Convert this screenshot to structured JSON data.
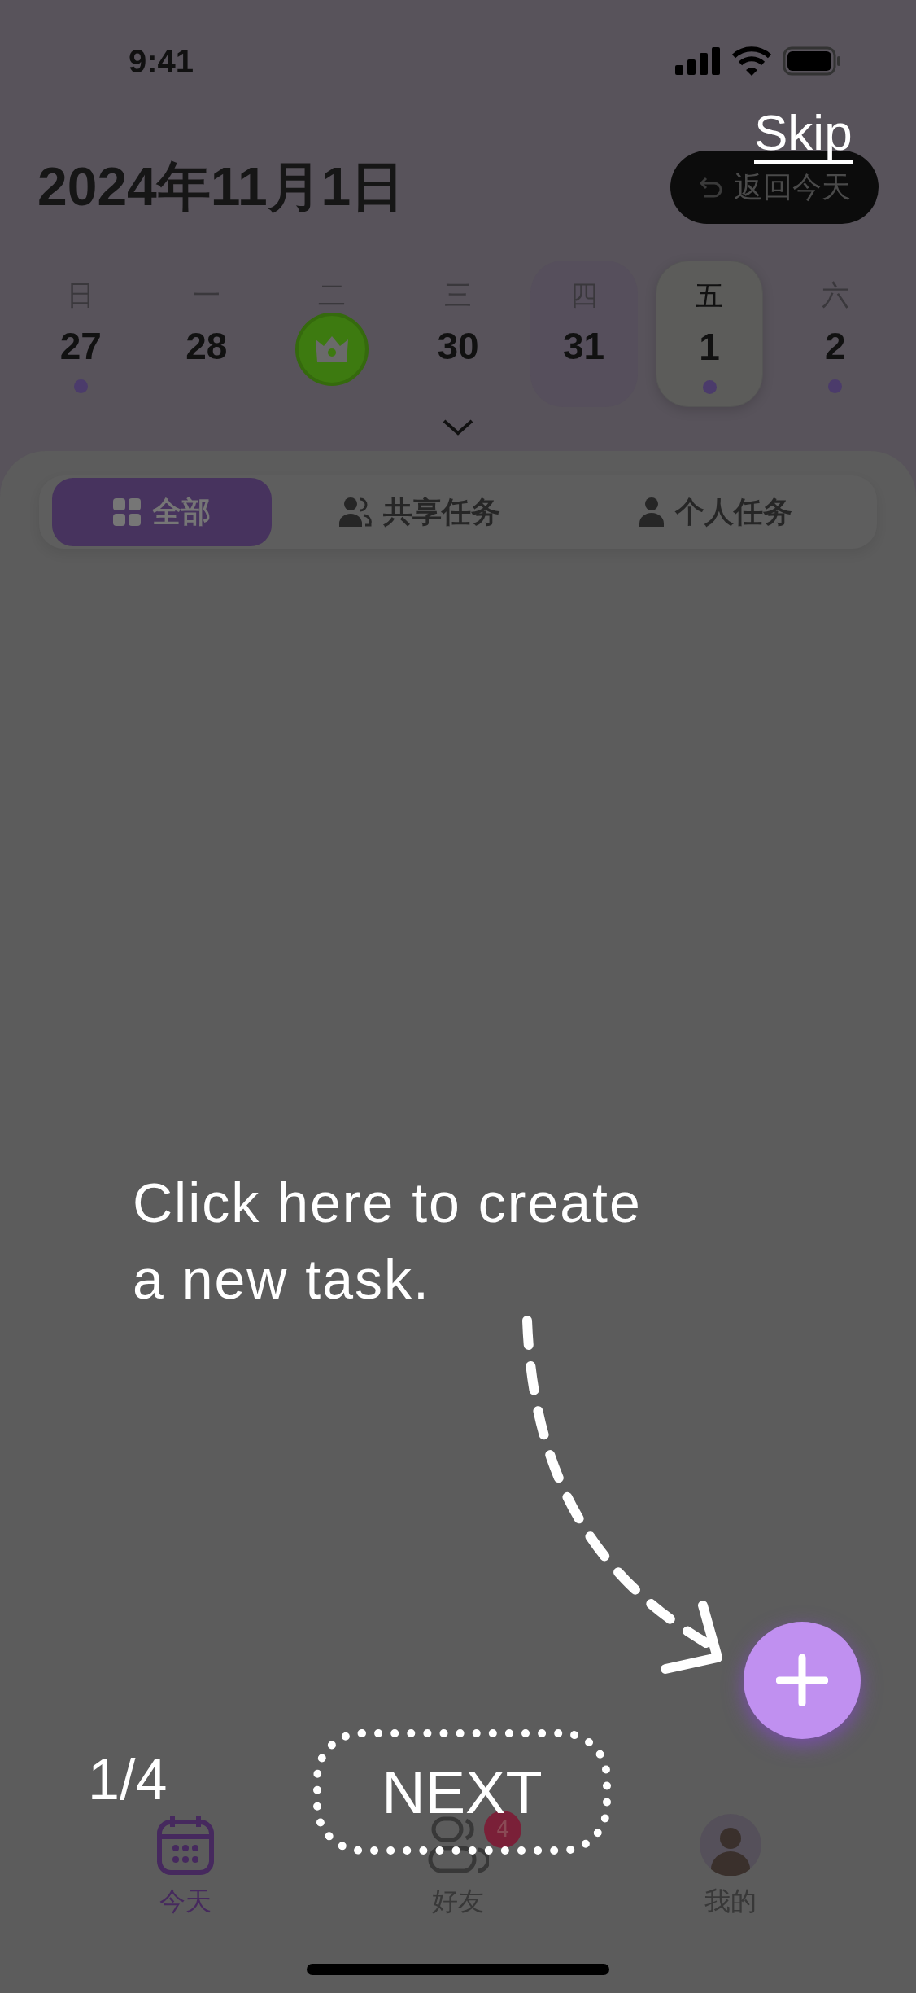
{
  "status_bar": {
    "time": "9:41"
  },
  "header": {
    "date_title": "2024年11月1日",
    "back_today_button": "返回今天"
  },
  "week": [
    {
      "weekday": "日",
      "day": "27",
      "kind": "date",
      "has_task": true,
      "today": false,
      "selected": false
    },
    {
      "weekday": "一",
      "day": "28",
      "kind": "date",
      "has_task": false,
      "today": false,
      "selected": false
    },
    {
      "weekday": "二",
      "kind": "badge",
      "has_task": false,
      "today": false,
      "selected": false
    },
    {
      "weekday": "三",
      "day": "30",
      "kind": "date",
      "has_task": false,
      "today": false,
      "selected": false
    },
    {
      "weekday": "四",
      "day": "31",
      "kind": "date",
      "has_task": false,
      "today": true,
      "selected": false
    },
    {
      "weekday": "五",
      "day": "1",
      "kind": "date",
      "has_task": true,
      "today": false,
      "selected": true
    },
    {
      "weekday": "六",
      "day": "2",
      "kind": "date",
      "has_task": true,
      "today": false,
      "selected": false
    }
  ],
  "filter_tabs": [
    {
      "label": "全部",
      "kind": "grid",
      "selected": true
    },
    {
      "label": "共享任务",
      "kind": "people",
      "selected": false
    },
    {
      "label": "个人任务",
      "kind": "person",
      "selected": false
    }
  ],
  "bottom_nav": [
    {
      "label": "今天",
      "kind": "calendar",
      "selected": true
    },
    {
      "label": "好友",
      "kind": "friends",
      "selected": false,
      "badge": "4"
    },
    {
      "label": "我的",
      "kind": "avatar",
      "selected": false
    }
  ],
  "onboarding": {
    "skip": "Skip",
    "hint": "Click here to create a new task.",
    "step": "1/4",
    "next": "NEXT"
  }
}
